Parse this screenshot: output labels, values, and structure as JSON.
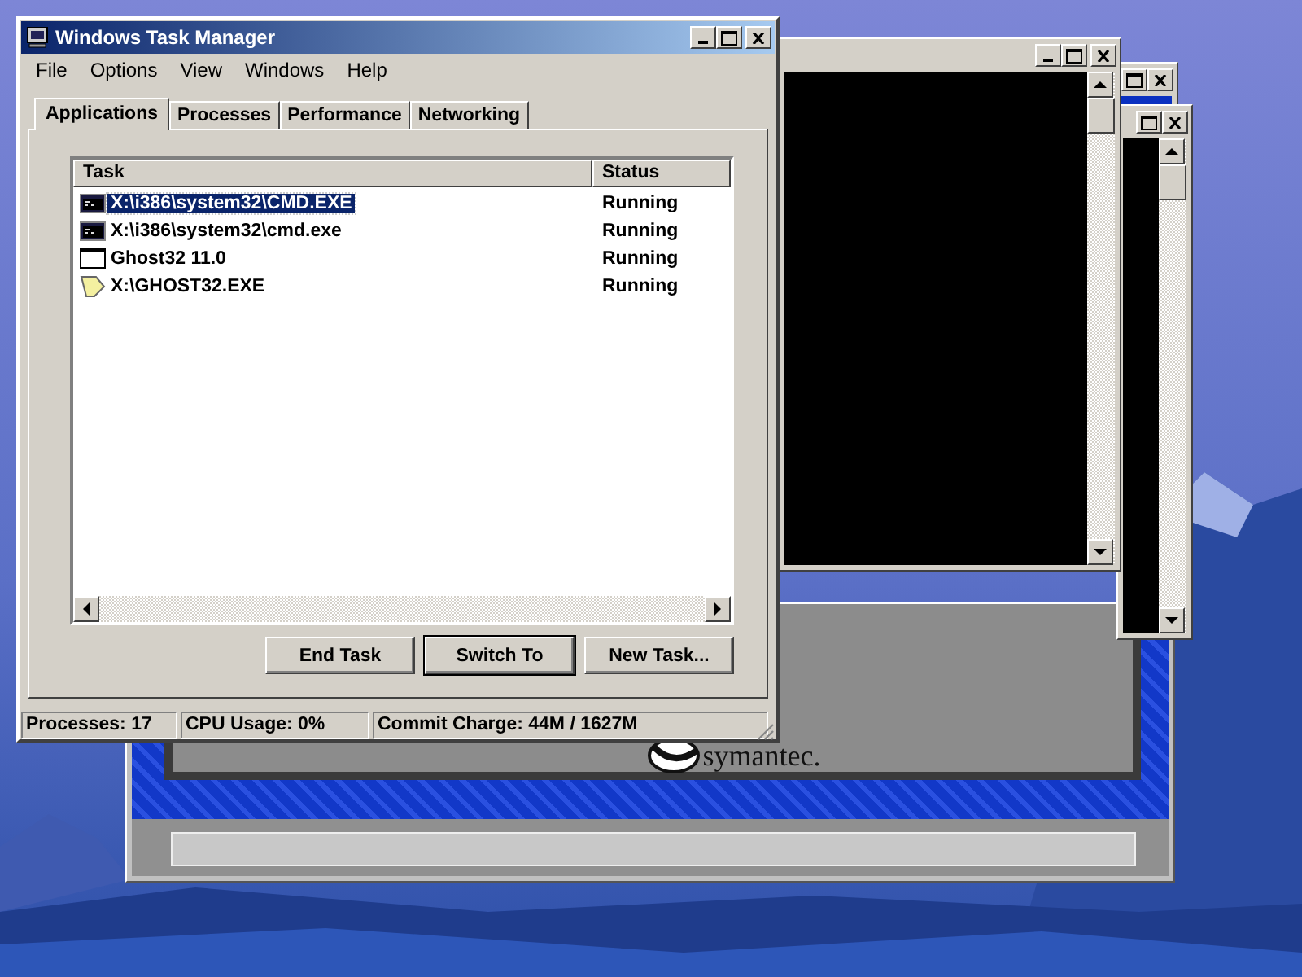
{
  "window": {
    "title": "Windows Task Manager"
  },
  "menu": [
    "File",
    "Options",
    "View",
    "Windows",
    "Help"
  ],
  "tabs": [
    {
      "label": "Applications",
      "selected": true
    },
    {
      "label": "Processes",
      "selected": false
    },
    {
      "label": "Performance",
      "selected": false
    },
    {
      "label": "Networking",
      "selected": false
    }
  ],
  "table": {
    "columns": [
      "Task",
      "Status"
    ],
    "rows": [
      {
        "task": "X:\\i386\\system32\\CMD.EXE",
        "status": "Running",
        "kind": "console",
        "selected": true
      },
      {
        "task": "X:\\i386\\system32\\cmd.exe",
        "status": "Running",
        "kind": "console",
        "selected": false
      },
      {
        "task": "Ghost32 11.0",
        "status": "Running",
        "kind": "window",
        "selected": false
      },
      {
        "task": "X:\\GHOST32.EXE",
        "status": "Running",
        "kind": "ghost",
        "selected": false
      }
    ]
  },
  "buttons": [
    {
      "label": "End Task",
      "default": false
    },
    {
      "label": "Switch To",
      "default": true
    },
    {
      "label": "New Task...",
      "default": false
    }
  ],
  "status_bar": [
    "Processes: 17",
    "CPU Usage: 0%",
    "Commit Charge: 44M / 1627M"
  ],
  "background_window": {
    "logo": "symantec."
  }
}
